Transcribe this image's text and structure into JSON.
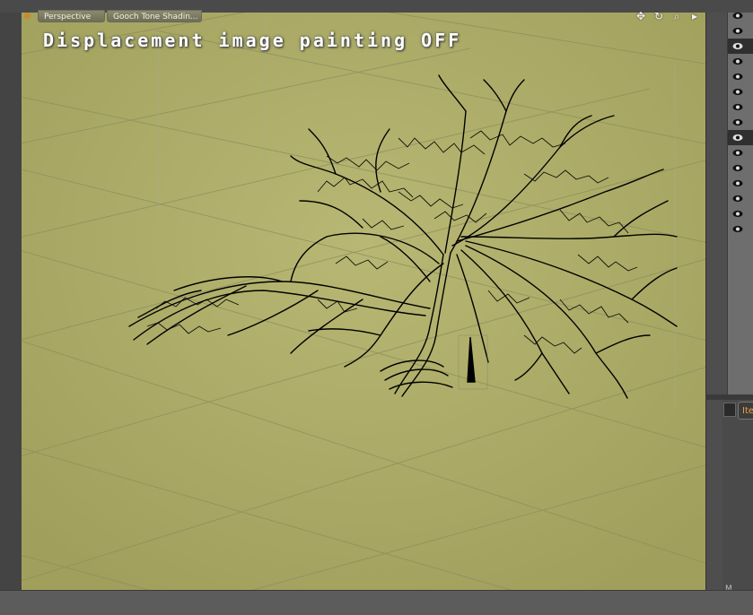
{
  "viewport": {
    "view_mode": "Perspective",
    "shading_mode": "Gooch Tone Shadin...",
    "overlay_text": "Displacement image painting OFF",
    "background_color": "#b0b06a",
    "grid_color": "#8c8c5a",
    "tools": [
      {
        "name": "move-view-icon",
        "glyph": "✥"
      },
      {
        "name": "rotate-view-icon",
        "glyph": "↻"
      },
      {
        "name": "zoom-view-icon",
        "glyph": "⌕"
      },
      {
        "name": "more-arrow-icon",
        "glyph": "▸"
      }
    ]
  },
  "scene": {
    "object": "tree-wireframe",
    "wire_color": "#000000"
  },
  "right_panel": {
    "visibility_rows": 15,
    "selected_rows": [
      2,
      8
    ],
    "item_tab_label": "Ite",
    "bottom_mark": "M"
  },
  "colors": {
    "accent_orange": "#e8a33a",
    "panel_dark": "#4e4e4e",
    "panel_light": "#6e6e6e"
  }
}
